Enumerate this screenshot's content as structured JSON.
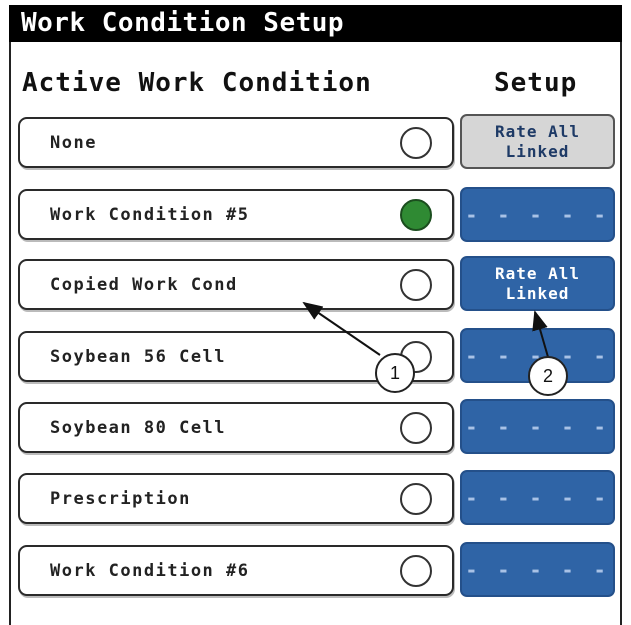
{
  "title": "Work Condition Setup",
  "columns": {
    "active": "Active Work Condition",
    "setup": "Setup"
  },
  "rows": [
    {
      "label": "None",
      "selected": false,
      "setup": "Rate All\nLinked",
      "setup_style": "gray"
    },
    {
      "label": "Work Condition #5",
      "selected": true,
      "setup": "- - - - -",
      "setup_style": "blue-dashes"
    },
    {
      "label": "Copied Work Cond",
      "selected": false,
      "setup": "Rate All\nLinked",
      "setup_style": "blue"
    },
    {
      "label": "Soybean 56 Cell",
      "selected": false,
      "setup": "- - - - -",
      "setup_style": "blue-dashes"
    },
    {
      "label": "Soybean 80 Cell",
      "selected": false,
      "setup": "- - - - -",
      "setup_style": "blue-dashes"
    },
    {
      "label": "Prescription",
      "selected": false,
      "setup": "- - - - -",
      "setup_style": "blue-dashes"
    },
    {
      "label": "Work Condition #6",
      "selected": false,
      "setup": "- - - - -",
      "setup_style": "blue-dashes"
    }
  ],
  "callouts": [
    "1",
    "2"
  ],
  "colors": {
    "title_bg": "#000000",
    "button_blue": "#2f64a6",
    "button_gray": "#d6d6d6",
    "selected_green": "#2f8a33"
  }
}
